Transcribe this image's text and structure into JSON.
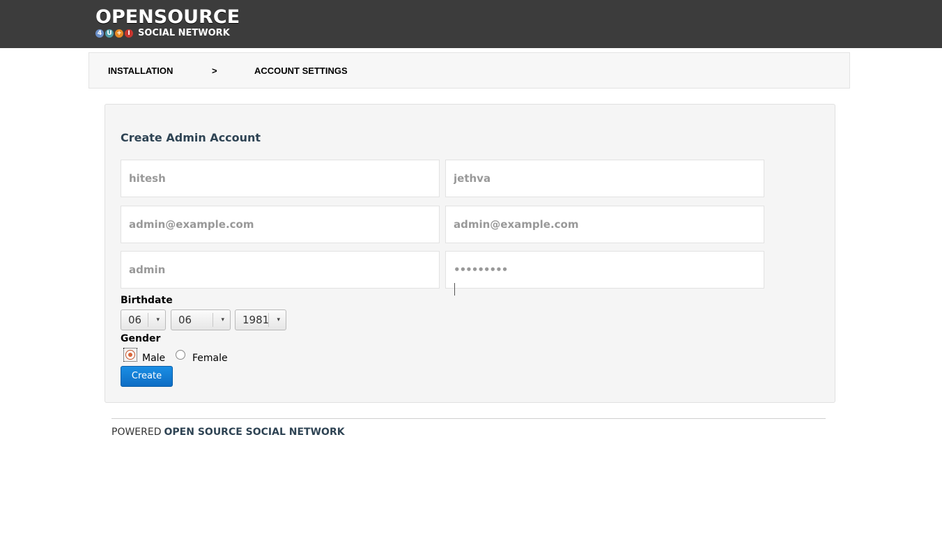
{
  "header": {
    "logo_title": "OPENSOURCE",
    "logo_badges": [
      {
        "char": "4",
        "color": "#6a8fc8"
      },
      {
        "char": "U",
        "color": "#4f9fa8"
      },
      {
        "char": "+",
        "color": "#e88a24"
      },
      {
        "char": "I",
        "color": "#c7362f"
      }
    ],
    "logo_subtitle": "SOCIAL NETWORK"
  },
  "breadcrumb": {
    "step1": "INSTALLATION",
    "separator": ">",
    "step2": "ACCOUNT SETTINGS"
  },
  "form": {
    "title": "Create Admin Account",
    "first_name": "hitesh",
    "last_name": "jethva",
    "email": "admin@example.com",
    "email_confirm": "admin@example.com",
    "username": "admin",
    "password": "•••••••••",
    "birthdate_label": "Birthdate",
    "birth_day": "06",
    "birth_month": "06",
    "birth_year": "1981",
    "dropdown_arrow": "▾",
    "gender_label": "Gender",
    "gender_male": "Male",
    "gender_female": "Female",
    "gender_selected": "male",
    "submit_label": "Create"
  },
  "footer": {
    "powered": "POWERED",
    "brand": "OPEN SOURCE SOCIAL NETWORK"
  }
}
